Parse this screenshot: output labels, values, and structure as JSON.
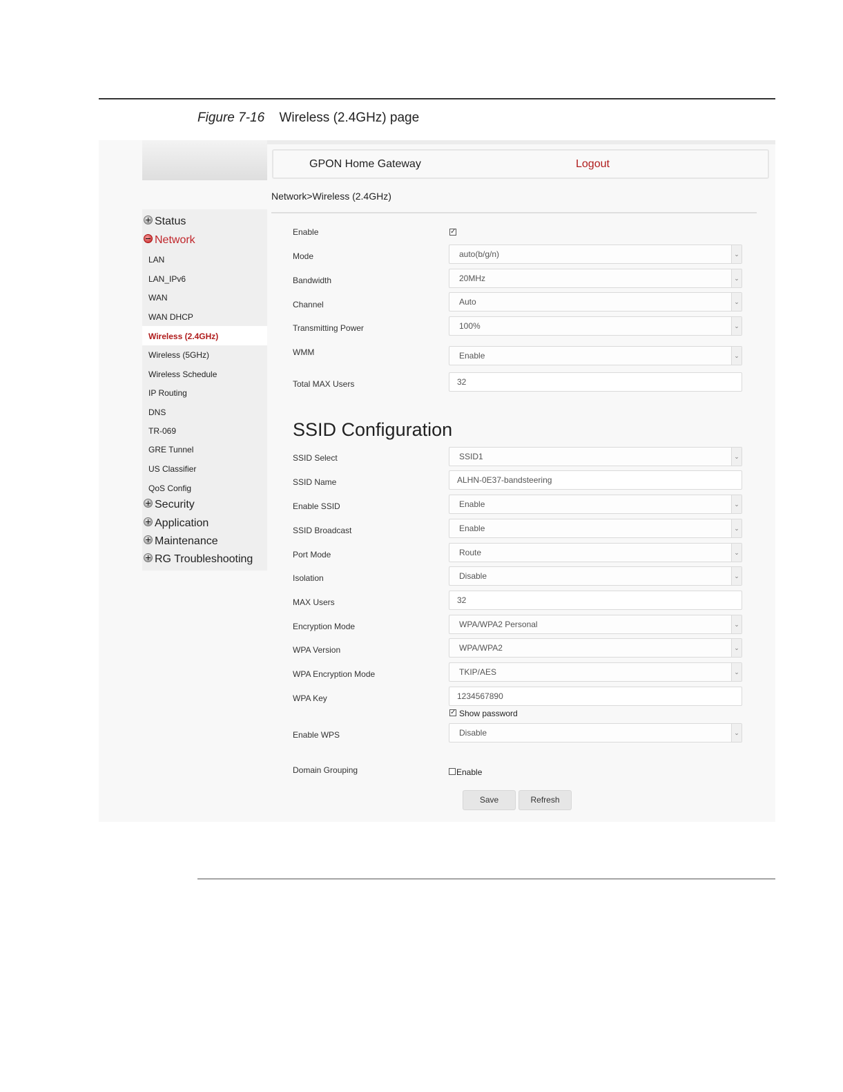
{
  "figure": {
    "number": "Figure 7-16",
    "title": "Wireless (2.4GHz) page"
  },
  "header": {
    "title": "GPON Home Gateway",
    "logout": "Logout"
  },
  "breadcrumb": "Network>Wireless (2.4GHz)",
  "nav": {
    "top": [
      "Status",
      "Network",
      "Security",
      "Application",
      "Maintenance",
      "RG Troubleshooting"
    ],
    "sub": [
      "LAN",
      "LAN_IPv6",
      "WAN",
      "WAN DHCP",
      "Wireless (2.4GHz)",
      "Wireless (5GHz)",
      "Wireless Schedule",
      "IP Routing",
      "DNS",
      "TR-069",
      "GRE Tunnel",
      "US Classifier",
      "QoS Config"
    ],
    "active_top": "Network",
    "active_sub": "Wireless (2.4GHz)"
  },
  "wireless": {
    "enable_label": "Enable",
    "enable_checked": true,
    "mode_label": "Mode",
    "mode_value": "auto(b/g/n)",
    "bandwidth_label": "Bandwidth",
    "bandwidth_value": "20MHz",
    "channel_label": "Channel",
    "channel_value": "Auto",
    "power_label": "Transmitting Power",
    "power_value": "100%",
    "wmm_label": "WMM",
    "wmm_value": "Enable",
    "total_max_label": "Total MAX Users",
    "total_max_value": "32"
  },
  "ssid": {
    "section_title": "SSID Configuration",
    "select_label": "SSID Select",
    "select_value": "SSID1",
    "name_label": "SSID Name",
    "name_value": "ALHN-0E37-bandsteering",
    "enable_label": "Enable SSID",
    "enable_value": "Enable",
    "broadcast_label": "SSID Broadcast",
    "broadcast_value": "Enable",
    "port_mode_label": "Port Mode",
    "port_mode_value": "Route",
    "isolation_label": "Isolation",
    "isolation_value": "Disable",
    "max_users_label": "MAX Users",
    "max_users_value": "32",
    "encryption_label": "Encryption Mode",
    "encryption_value": "WPA/WPA2 Personal",
    "wpa_version_label": "WPA Version",
    "wpa_version_value": "WPA/WPA2",
    "wpa_enc_label": "WPA Encryption Mode",
    "wpa_enc_value": "TKIP/AES",
    "wpa_key_label": "WPA Key",
    "wpa_key_value": "1234567890",
    "show_password_label": "Show password",
    "show_password_checked": true,
    "wps_label": "Enable WPS",
    "wps_value": "Disable",
    "domain_label": "Domain Grouping",
    "domain_enable_label": "Enable",
    "domain_checked": false
  },
  "buttons": {
    "save": "Save",
    "refresh": "Refresh"
  },
  "colors": {
    "accent_red": "#b01c1c",
    "sidebar_bg": "#efefef"
  }
}
